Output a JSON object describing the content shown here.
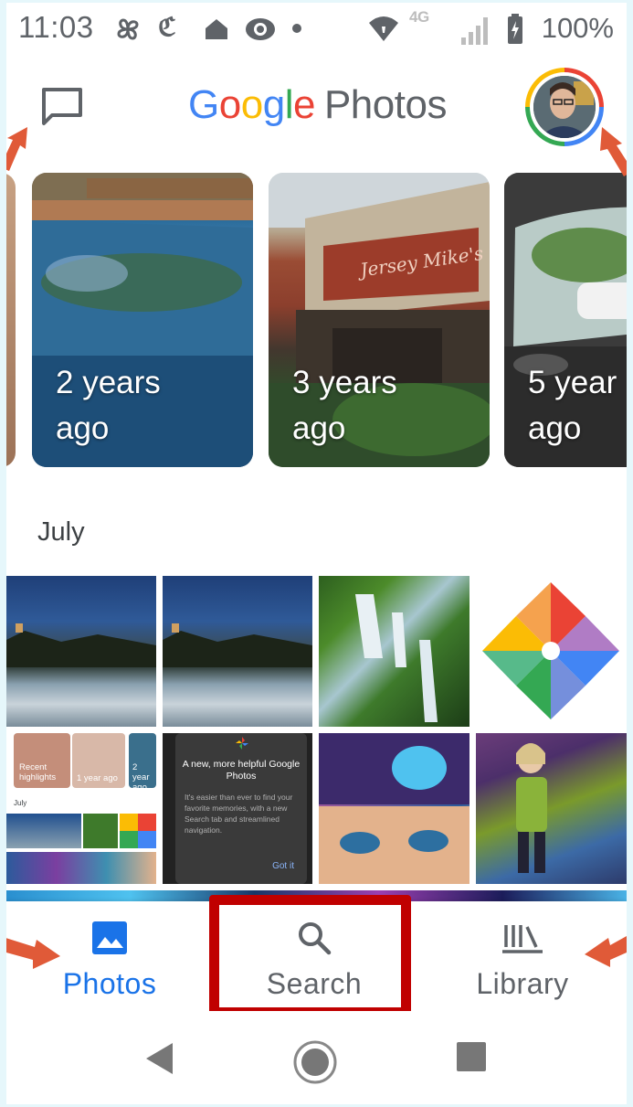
{
  "status_bar": {
    "time": "11:03",
    "network": "4G",
    "battery": "100%"
  },
  "header": {
    "logo_google": [
      "G",
      "o",
      "o",
      "g",
      "l",
      "e"
    ],
    "logo_colors": [
      "#4285f4",
      "#ea4335",
      "#fbbc05",
      "#4285f4",
      "#34a853",
      "#ea4335"
    ],
    "logo_photos": "Photos",
    "chat_icon": "message-icon",
    "avatar_icon": "account-avatar"
  },
  "memories": [
    {
      "caption_line1": "2 years",
      "caption_line2": "ago"
    },
    {
      "caption_line1": "3 years",
      "caption_line2": "ago"
    },
    {
      "caption_line1": "5 year",
      "caption_line2": "ago"
    }
  ],
  "section": {
    "title": "July"
  },
  "grid_screenshot": {
    "card_title": "A new, more helpful Google Photos",
    "card_body": "It's easier than ever to find your favorite memories, with a new Search tab and streamlined navigation.",
    "card_button": "Got it",
    "mini_recent": "Recent highlights",
    "mini_year": "1 year ago",
    "mini_two_year": "2 year ago",
    "mini_month": "July"
  },
  "comic_sign": "Jersey Mike's Subs",
  "bottom_nav": {
    "photos": "Photos",
    "search": "Search",
    "library": "Library",
    "active": "Photos"
  },
  "colors": {
    "accent": "#1a73e8",
    "highlight_box": "#c00000",
    "arrow": "#e05a38"
  }
}
